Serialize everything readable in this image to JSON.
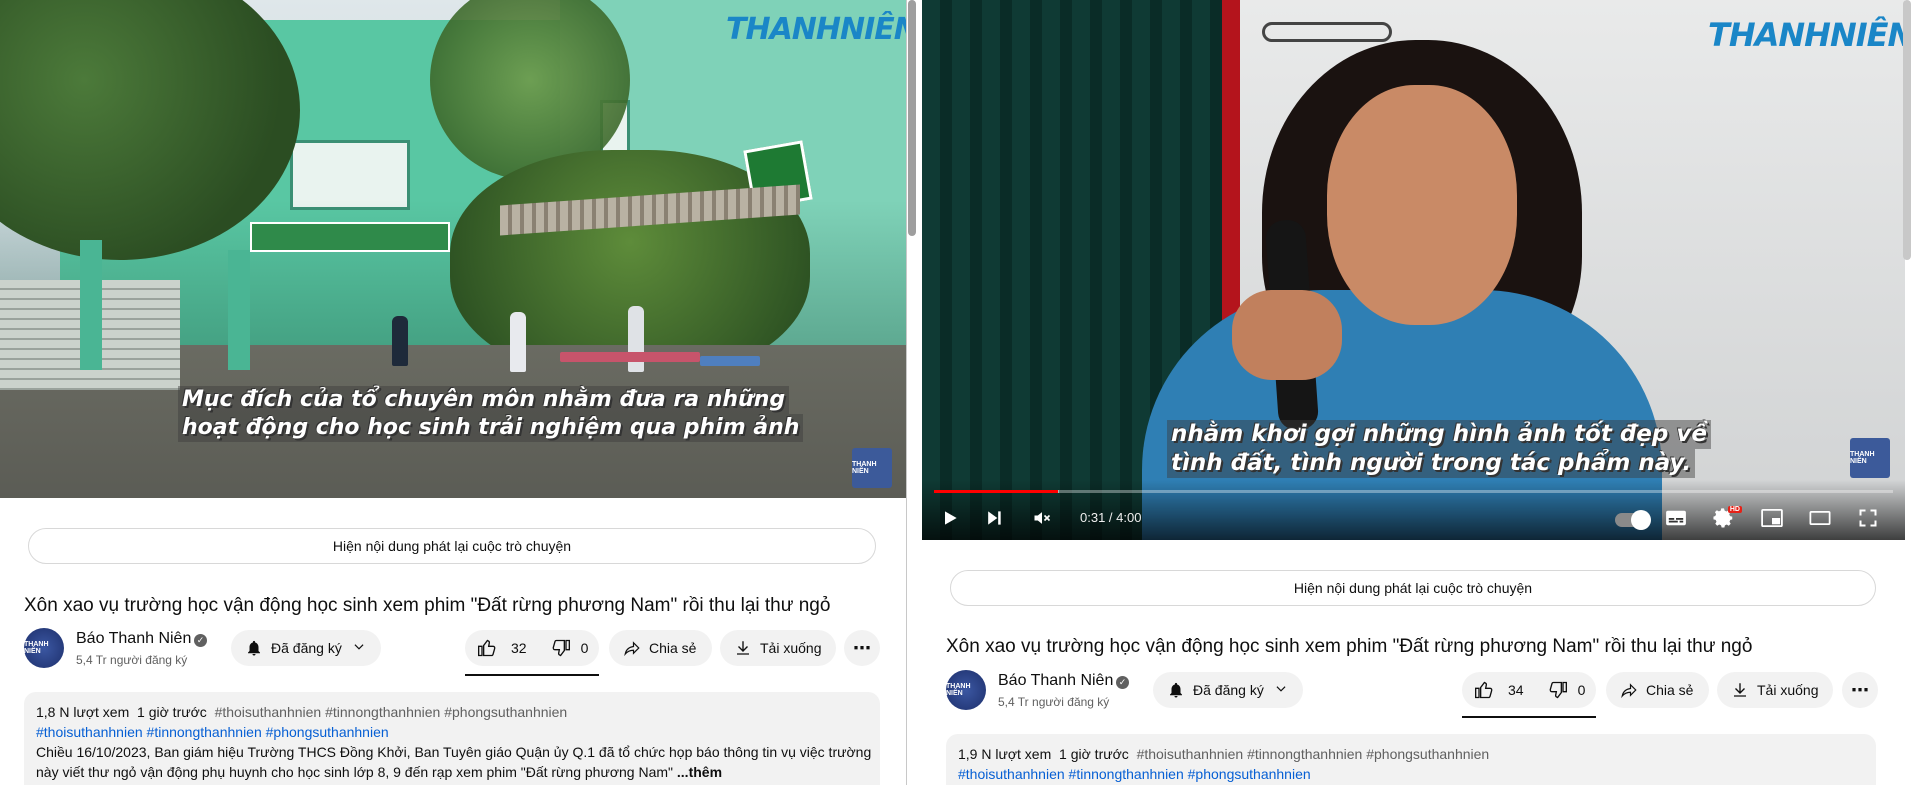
{
  "left": {
    "video": {
      "watermark": "THANHNIÊN",
      "corner_logo": "THANH NIÊN",
      "subtitle_line1": "Mục đích của tổ chuyên môn nhằm đưa ra những",
      "subtitle_line2": "hoạt động cho học sinh trải nghiệm qua phim ảnh"
    },
    "chat_replay": "Hiện nội dung phát lại cuộc trò chuyện",
    "title": "Xôn xao vụ trường học vận động học sinh xem phim \"Đất rừng phương Nam\" rồi thu lại thư ngỏ",
    "channel": {
      "name": "Báo Thanh Niên",
      "verified": "✓",
      "subscribers": "5,4 Tr người đăng ký",
      "avatar_text": "THANH NIÊN"
    },
    "subscribe_label": "Đã đăng ký",
    "likes": "32",
    "dislikes": "0",
    "share_label": "Chia sẻ",
    "download_label": "Tải xuống",
    "description": {
      "views": "1,8 N lượt xem",
      "time": "1 giờ trước",
      "tags_inline": "#thoisuthanhnien #tinnongthanhnien #phongsuthanhnien",
      "hashtags": "#thoisuthanhnien #tinnongthanhnien #phongsuthanhnien",
      "text_line1": "Chiều 16/10/2023, Ban giám hiệu Trường THCS Đồng Khởi, Ban Tuyên giáo Quận ủy Q.1 đã tổ chức họp báo thông tin vụ việc trường",
      "text_line2": "này viết thư ngỏ vận động phụ huynh cho học sinh lớp 8, 9 đến rạp xem phim \"Đất rừng phương Nam\"",
      "more": "...thêm"
    }
  },
  "right": {
    "video": {
      "watermark": "THANHNIÊN",
      "corner_logo": "THANH NIÊN",
      "subtitle_line1": "nhằm khơi gợi những hình ảnh tốt đẹp về",
      "subtitle_line2": "tình đất, tình người trong tác phẩm này.",
      "time": "0:31 / 4:00",
      "progress": 0.129,
      "buffered": 0.13,
      "hd_badge": "HD"
    },
    "chat_replay": "Hiện nội dung phát lại cuộc trò chuyện",
    "title": "Xôn xao vụ trường học vận động học sinh xem phim \"Đất rừng phương Nam\" rồi thu lại thư ngỏ",
    "channel": {
      "name": "Báo Thanh Niên",
      "verified": "✓",
      "subscribers": "5,4 Tr người đăng ký",
      "avatar_text": "THANH NIÊN"
    },
    "subscribe_label": "Đã đăng ký",
    "likes": "34",
    "dislikes": "0",
    "share_label": "Chia sẻ",
    "download_label": "Tải xuống",
    "description": {
      "views": "1,9 N lượt xem",
      "time": "1 giờ trước",
      "tags_inline": "#thoisuthanhnien #tinnongthanhnien #phongsuthanhnien",
      "hashtags": "#thoisuthanhnien #tinnongthanhnien #phongsuthanhnien"
    }
  },
  "colors": {
    "brand_blue": "#1a86c7",
    "progress_red": "#ff0000",
    "pill_bg": "#f2f2f2",
    "hashtag_blue": "#065fd4"
  },
  "icons": {
    "play": "play-icon",
    "next": "next-icon",
    "mute": "volume-muted-icon",
    "subtitles": "subtitles-icon",
    "settings": "gear-icon",
    "miniplayer": "miniplayer-icon",
    "theater": "theater-icon",
    "fullscreen": "fullscreen-icon",
    "bell": "bell-icon",
    "like": "thumbs-up-icon",
    "dislike": "thumbs-down-icon",
    "share": "share-icon",
    "download": "download-icon",
    "more": "more-icon"
  }
}
